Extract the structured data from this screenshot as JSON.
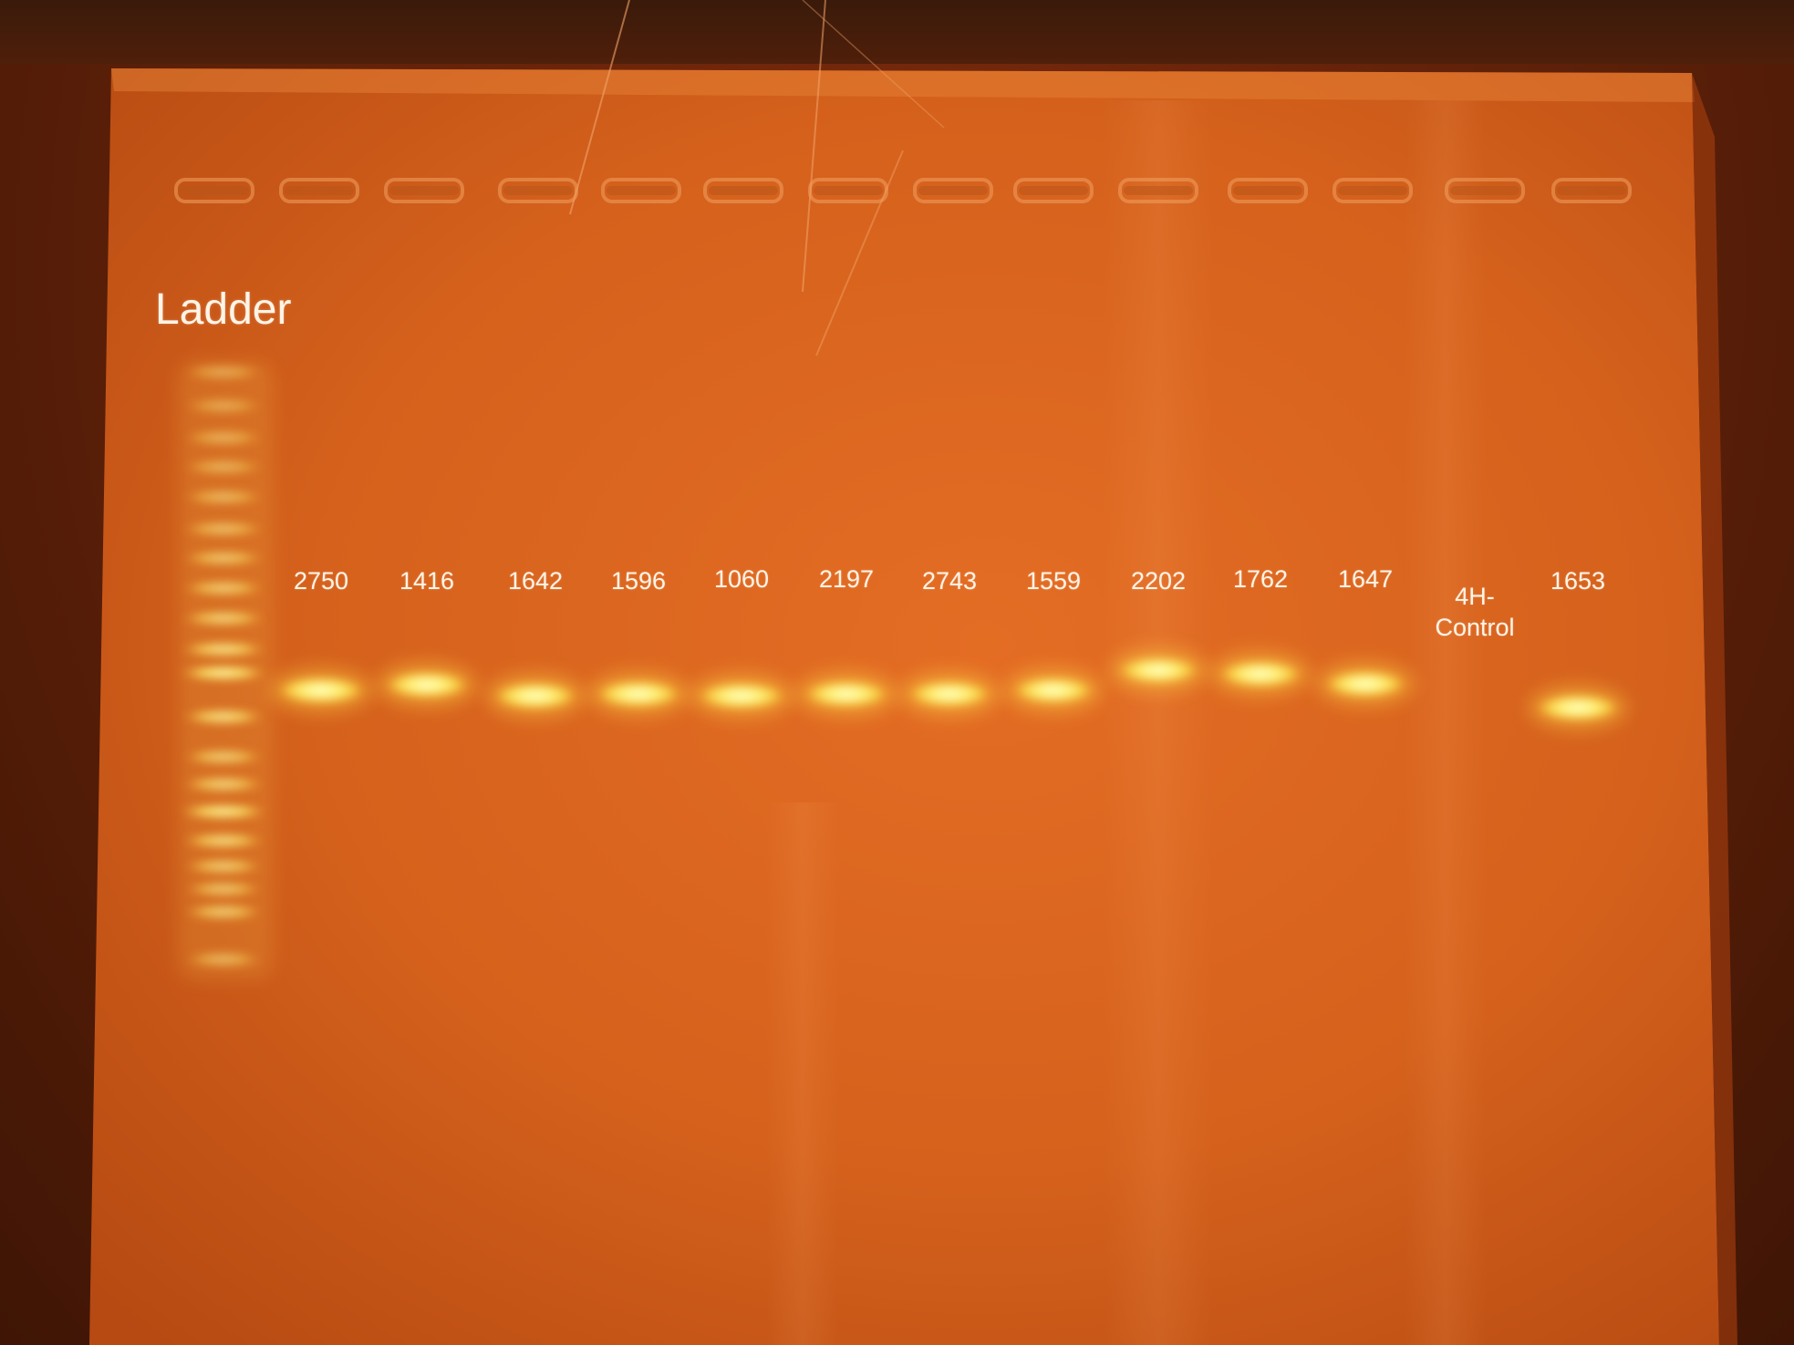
{
  "ladder_label": "Ladder",
  "lanes": [
    {
      "label": "2750",
      "band": true
    },
    {
      "label": "1416",
      "band": true
    },
    {
      "label": "1642",
      "band": true
    },
    {
      "label": "1596",
      "band": true
    },
    {
      "label": "1060",
      "band": true
    },
    {
      "label": "2197",
      "band": true
    },
    {
      "label": "2743",
      "band": true
    },
    {
      "label": "1559",
      "band": true
    },
    {
      "label": "2202",
      "band": true
    },
    {
      "label": "1762",
      "band": true
    },
    {
      "label": "1647",
      "band": true
    },
    {
      "label_line1": "4H-",
      "label_line2": "Control",
      "band": false
    },
    {
      "label": "1653",
      "band": true
    }
  ],
  "colors": {
    "background": "#5a1f08",
    "gel": "#d8621e",
    "band": "#fff27a",
    "label_text": "#fff4e6"
  }
}
